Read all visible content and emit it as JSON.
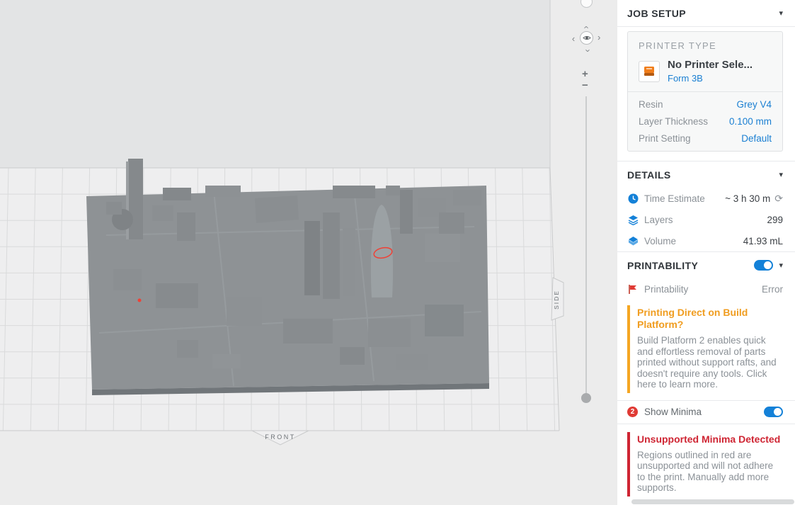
{
  "icons": {
    "caret_down": "▾",
    "refresh": "⟳",
    "chevron": "‹"
  },
  "nav": {
    "zoom_in": "+",
    "zoom_out": "−"
  },
  "viewport": {
    "front_label": "FRONT",
    "side_label": "SIDE"
  },
  "colors": {
    "accent_blue": "#1a7fd2",
    "warning_orange": "#f5a623",
    "error_red": "#cf2533",
    "minima_marker_red": "#ef4136",
    "toggle_on": "#1481d8"
  },
  "sidebar": {
    "job_setup_title": "JOB SETUP",
    "printer_card": {
      "type_label": "PRINTER TYPE",
      "name": "No Printer Sele...",
      "model": "Form 3B",
      "rows": [
        {
          "label": "Resin",
          "value": "Grey V4"
        },
        {
          "label": "Layer Thickness",
          "value": "0.100 mm"
        },
        {
          "label": "Print Setting",
          "value": "Default"
        }
      ]
    },
    "details_title": "DETAILS",
    "details_rows": [
      {
        "label": "Time Estimate",
        "value": "~ 3 h 30 m"
      },
      {
        "label": "Layers",
        "value": "299"
      },
      {
        "label": "Volume",
        "value": "41.93 mL"
      }
    ],
    "printability_title": "PRINTABILITY",
    "printability_row": {
      "label": "Printability",
      "value": "Error"
    },
    "platform_tip": {
      "title": "Printing Direct on Build Platform?",
      "body": "Build Platform 2 enables quick and effortless removal of parts printed without support rafts, and doesn't require any tools.",
      "link": "Click here to learn more."
    },
    "show_minima": {
      "badge": "2",
      "label": "Show Minima"
    },
    "minima_alert": {
      "title": "Unsupported Minima Detected",
      "body": "Regions outlined in red are unsupported and will not adhere to the print. Manually add more supports."
    }
  }
}
